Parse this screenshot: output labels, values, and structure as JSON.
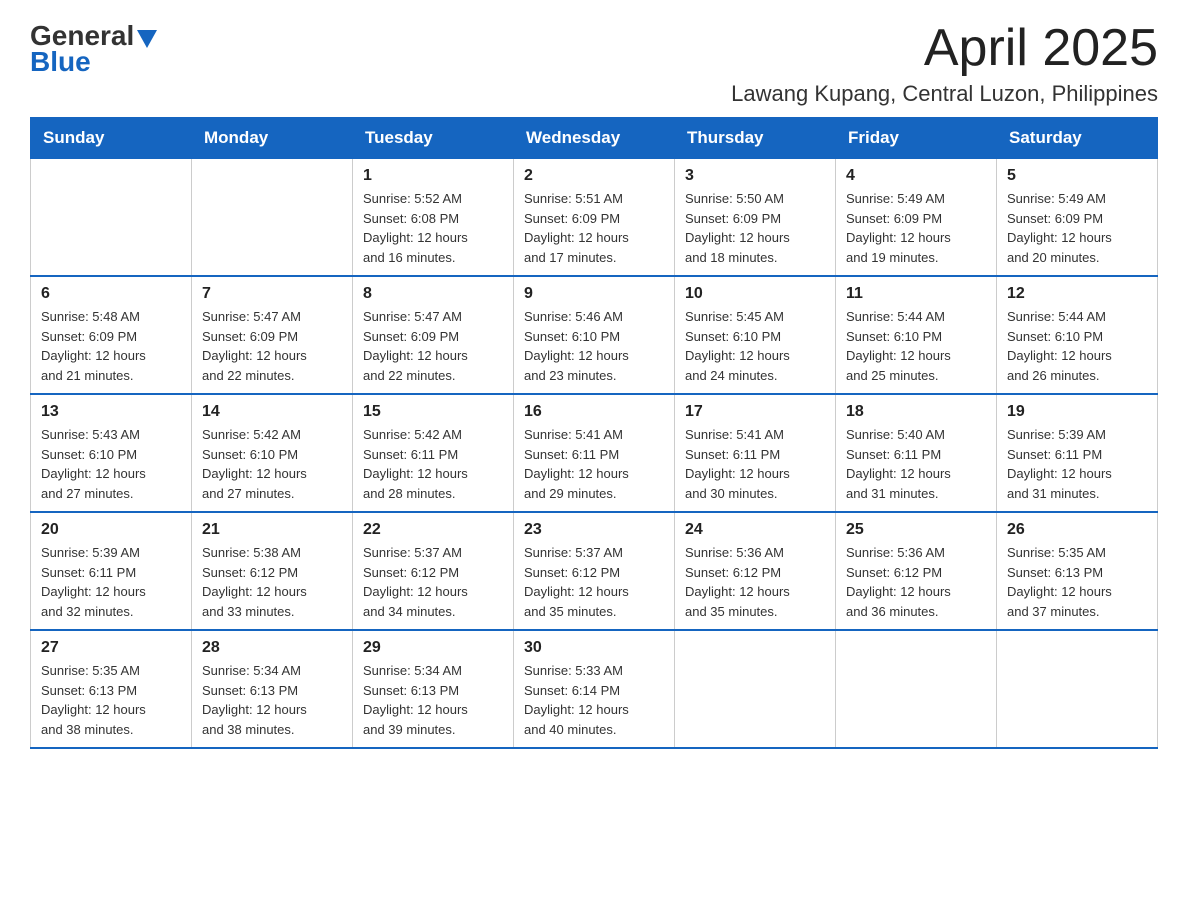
{
  "logo": {
    "general": "General",
    "blue": "Blue"
  },
  "title": {
    "month_year": "April 2025",
    "location": "Lawang Kupang, Central Luzon, Philippines"
  },
  "header_days": [
    "Sunday",
    "Monday",
    "Tuesday",
    "Wednesday",
    "Thursday",
    "Friday",
    "Saturday"
  ],
  "weeks": [
    {
      "days": [
        {
          "number": "",
          "info": ""
        },
        {
          "number": "",
          "info": ""
        },
        {
          "number": "1",
          "info": "Sunrise: 5:52 AM\nSunset: 6:08 PM\nDaylight: 12 hours\nand 16 minutes."
        },
        {
          "number": "2",
          "info": "Sunrise: 5:51 AM\nSunset: 6:09 PM\nDaylight: 12 hours\nand 17 minutes."
        },
        {
          "number": "3",
          "info": "Sunrise: 5:50 AM\nSunset: 6:09 PM\nDaylight: 12 hours\nand 18 minutes."
        },
        {
          "number": "4",
          "info": "Sunrise: 5:49 AM\nSunset: 6:09 PM\nDaylight: 12 hours\nand 19 minutes."
        },
        {
          "number": "5",
          "info": "Sunrise: 5:49 AM\nSunset: 6:09 PM\nDaylight: 12 hours\nand 20 minutes."
        }
      ]
    },
    {
      "days": [
        {
          "number": "6",
          "info": "Sunrise: 5:48 AM\nSunset: 6:09 PM\nDaylight: 12 hours\nand 21 minutes."
        },
        {
          "number": "7",
          "info": "Sunrise: 5:47 AM\nSunset: 6:09 PM\nDaylight: 12 hours\nand 22 minutes."
        },
        {
          "number": "8",
          "info": "Sunrise: 5:47 AM\nSunset: 6:09 PM\nDaylight: 12 hours\nand 22 minutes."
        },
        {
          "number": "9",
          "info": "Sunrise: 5:46 AM\nSunset: 6:10 PM\nDaylight: 12 hours\nand 23 minutes."
        },
        {
          "number": "10",
          "info": "Sunrise: 5:45 AM\nSunset: 6:10 PM\nDaylight: 12 hours\nand 24 minutes."
        },
        {
          "number": "11",
          "info": "Sunrise: 5:44 AM\nSunset: 6:10 PM\nDaylight: 12 hours\nand 25 minutes."
        },
        {
          "number": "12",
          "info": "Sunrise: 5:44 AM\nSunset: 6:10 PM\nDaylight: 12 hours\nand 26 minutes."
        }
      ]
    },
    {
      "days": [
        {
          "number": "13",
          "info": "Sunrise: 5:43 AM\nSunset: 6:10 PM\nDaylight: 12 hours\nand 27 minutes."
        },
        {
          "number": "14",
          "info": "Sunrise: 5:42 AM\nSunset: 6:10 PM\nDaylight: 12 hours\nand 27 minutes."
        },
        {
          "number": "15",
          "info": "Sunrise: 5:42 AM\nSunset: 6:11 PM\nDaylight: 12 hours\nand 28 minutes."
        },
        {
          "number": "16",
          "info": "Sunrise: 5:41 AM\nSunset: 6:11 PM\nDaylight: 12 hours\nand 29 minutes."
        },
        {
          "number": "17",
          "info": "Sunrise: 5:41 AM\nSunset: 6:11 PM\nDaylight: 12 hours\nand 30 minutes."
        },
        {
          "number": "18",
          "info": "Sunrise: 5:40 AM\nSunset: 6:11 PM\nDaylight: 12 hours\nand 31 minutes."
        },
        {
          "number": "19",
          "info": "Sunrise: 5:39 AM\nSunset: 6:11 PM\nDaylight: 12 hours\nand 31 minutes."
        }
      ]
    },
    {
      "days": [
        {
          "number": "20",
          "info": "Sunrise: 5:39 AM\nSunset: 6:11 PM\nDaylight: 12 hours\nand 32 minutes."
        },
        {
          "number": "21",
          "info": "Sunrise: 5:38 AM\nSunset: 6:12 PM\nDaylight: 12 hours\nand 33 minutes."
        },
        {
          "number": "22",
          "info": "Sunrise: 5:37 AM\nSunset: 6:12 PM\nDaylight: 12 hours\nand 34 minutes."
        },
        {
          "number": "23",
          "info": "Sunrise: 5:37 AM\nSunset: 6:12 PM\nDaylight: 12 hours\nand 35 minutes."
        },
        {
          "number": "24",
          "info": "Sunrise: 5:36 AM\nSunset: 6:12 PM\nDaylight: 12 hours\nand 35 minutes."
        },
        {
          "number": "25",
          "info": "Sunrise: 5:36 AM\nSunset: 6:12 PM\nDaylight: 12 hours\nand 36 minutes."
        },
        {
          "number": "26",
          "info": "Sunrise: 5:35 AM\nSunset: 6:13 PM\nDaylight: 12 hours\nand 37 minutes."
        }
      ]
    },
    {
      "days": [
        {
          "number": "27",
          "info": "Sunrise: 5:35 AM\nSunset: 6:13 PM\nDaylight: 12 hours\nand 38 minutes."
        },
        {
          "number": "28",
          "info": "Sunrise: 5:34 AM\nSunset: 6:13 PM\nDaylight: 12 hours\nand 38 minutes."
        },
        {
          "number": "29",
          "info": "Sunrise: 5:34 AM\nSunset: 6:13 PM\nDaylight: 12 hours\nand 39 minutes."
        },
        {
          "number": "30",
          "info": "Sunrise: 5:33 AM\nSunset: 6:14 PM\nDaylight: 12 hours\nand 40 minutes."
        },
        {
          "number": "",
          "info": ""
        },
        {
          "number": "",
          "info": ""
        },
        {
          "number": "",
          "info": ""
        }
      ]
    }
  ]
}
